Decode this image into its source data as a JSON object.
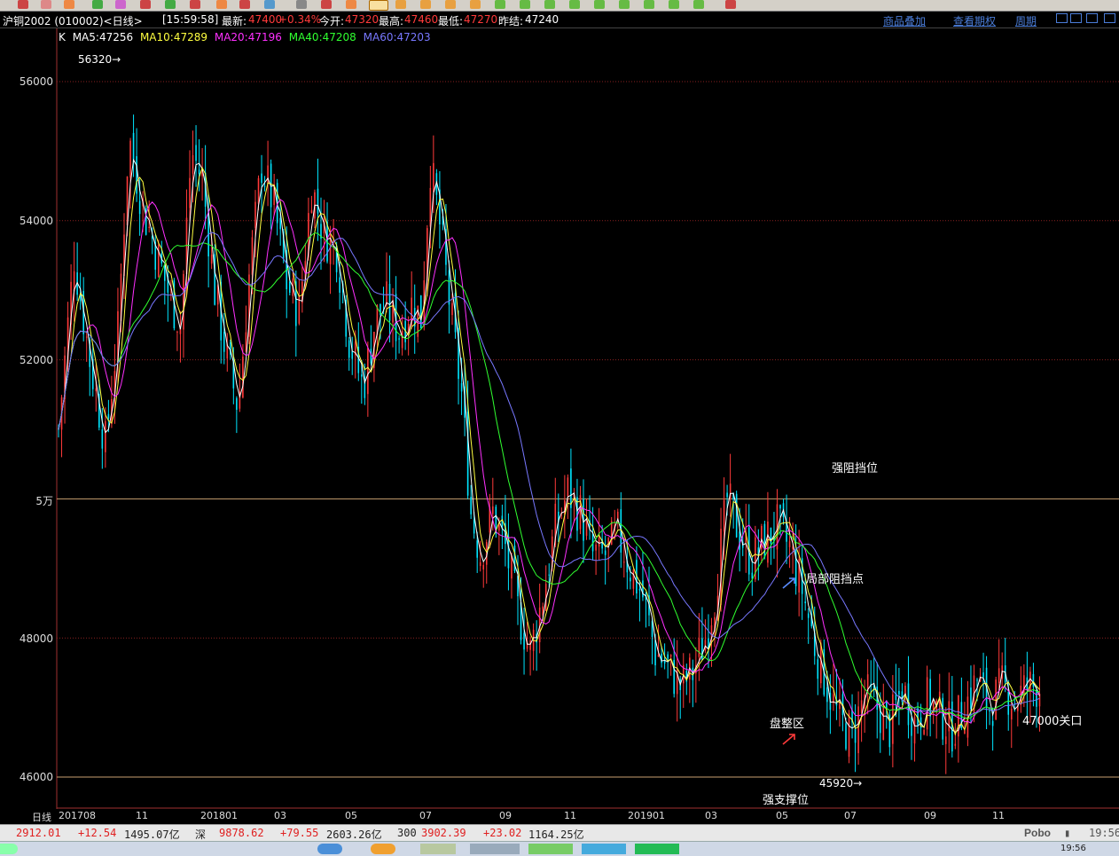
{
  "header": {
    "symbol": "沪铜2002 (010002)<日线>",
    "time": "[15:59:58]",
    "latest_label": "最新:",
    "latest": "47400",
    "change": "+0.34%",
    "open_label": "今开:",
    "open": "47320",
    "high_label": "最高:",
    "high": "47460",
    "low_label": "最低:",
    "low": "47270",
    "prev_label": "昨结:",
    "prev": "47240",
    "link_overlay": "商品叠加",
    "link_options": "查看期权",
    "link_period": "周期"
  },
  "legend": {
    "k": "K",
    "ma5": "MA5:47256",
    "ma10": "MA10:47289",
    "ma20": "MA20:47196",
    "ma40": "MA40:47208",
    "ma60": "MA60:47203"
  },
  "colors": {
    "up": "#ff3a3a",
    "down": "#00e5ff",
    "ma5": "#ffffff",
    "ma10": "#ffff40",
    "ma20": "#ff30ff",
    "ma40": "#30ff30",
    "ma60": "#7878ff"
  },
  "yaxis": {
    "labels": [
      "56000",
      "54000",
      "52000",
      "5万",
      "48000",
      "46000"
    ]
  },
  "xaxis": {
    "period_label": "日线",
    "labels": [
      "201708",
      "11",
      "201801",
      "03",
      "05",
      "07",
      "09",
      "11",
      "201901",
      "03",
      "05",
      "07",
      "09",
      "11"
    ]
  },
  "annotations": {
    "max_marker": "56320→",
    "min_marker": "45920→",
    "resistance": "强阻挡位",
    "local_resistance": "局部阻挡点",
    "consolidation": "盘整区",
    "support": "强支撑位",
    "key_level": "47000关口"
  },
  "chart_data": {
    "type": "candlestick",
    "y_axis_ticks": [
      56000,
      54000,
      52000,
      50000,
      48000,
      46000
    ],
    "highlighted_levels": [
      50000,
      46000
    ],
    "period_high": 56320,
    "period_low": 45920,
    "last_ma": {
      "MA5": 47256,
      "MA10": 47289,
      "MA20": 47196,
      "MA40": 47208,
      "MA60": 47203
    },
    "x_ticks": [
      "201708",
      "11",
      "201801",
      "03",
      "05",
      "07",
      "09",
      "11",
      "201901",
      "03",
      "05",
      "07",
      "09",
      "11"
    ]
  },
  "footer": {
    "sh_value": "2912.01",
    "sh_change": "+12.54",
    "sh_amount": "1495.07亿",
    "sz_label": "深",
    "sz_value": "9878.62",
    "sz_change": "+79.55",
    "sz_amount": "2603.26亿",
    "cyb_label": "300",
    "cyb_value": "3902.39",
    "cyb_change": "+23.02",
    "cyb_amount": "1164.25亿",
    "brand": "Pobo",
    "clock": "19:56"
  },
  "taskbar": {
    "clock": "19:56"
  }
}
